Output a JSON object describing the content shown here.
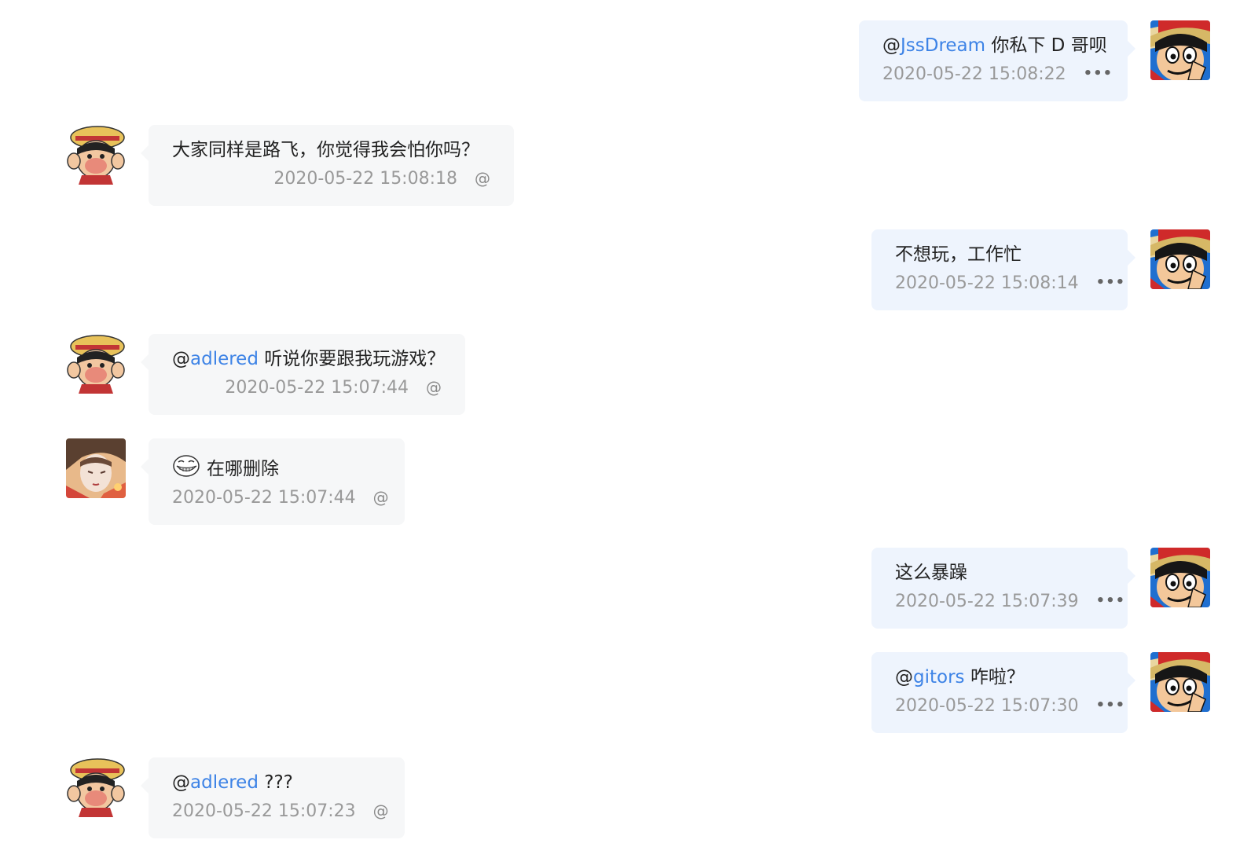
{
  "colors": {
    "mention": "#3d83e6",
    "bubble_left": "#f6f7f8",
    "bubble_right": "#eef4fd",
    "timestamp": "#999999"
  },
  "messages": [
    {
      "side": "right",
      "avatar": "luffy-wink-avatar",
      "prefix": "@",
      "mention": "JssDream",
      "text": " 你私下 D 哥呗",
      "time": "2020-05-22 15:08:22",
      "action_icon": "more-dots-icon"
    },
    {
      "side": "left",
      "avatar": "luffy-puffed-cheeks-avatar",
      "prefix": "",
      "mention": "",
      "text": "大家同样是路飞，你觉得我会怕你吗？",
      "time": "2020-05-22 15:08:18",
      "action": "@"
    },
    {
      "side": "right",
      "avatar": "luffy-wink-avatar",
      "prefix": "",
      "mention": "",
      "text": "不想玩，工作忙",
      "time": "2020-05-22 15:08:14",
      "action_icon": "more-dots-icon"
    },
    {
      "side": "left",
      "avatar": "luffy-puffed-cheeks-avatar",
      "prefix": "@",
      "mention": "adlered",
      "text": " 听说你要跟我玩游戏？",
      "time": "2020-05-22 15:07:44",
      "action": "@"
    },
    {
      "side": "left",
      "avatar": "anime-character-avatar",
      "emoji": "trollface-emoji",
      "prefix": "",
      "mention": "",
      "text": "在哪删除",
      "time": "2020-05-22 15:07:44",
      "action": "@"
    },
    {
      "side": "right",
      "avatar": "luffy-wink-avatar",
      "prefix": "",
      "mention": "",
      "text": "这么暴躁",
      "time": "2020-05-22 15:07:39",
      "action_icon": "more-dots-icon"
    },
    {
      "side": "right",
      "avatar": "luffy-wink-avatar",
      "prefix": "@",
      "mention": "gitors",
      "text": " 咋啦？",
      "time": "2020-05-22 15:07:30",
      "action_icon": "more-dots-icon"
    },
    {
      "side": "left",
      "avatar": "luffy-puffed-cheeks-avatar",
      "prefix": "@",
      "mention": "adlered",
      "text": " ???",
      "time": "2020-05-22 15:07:23",
      "action": "@"
    }
  ]
}
